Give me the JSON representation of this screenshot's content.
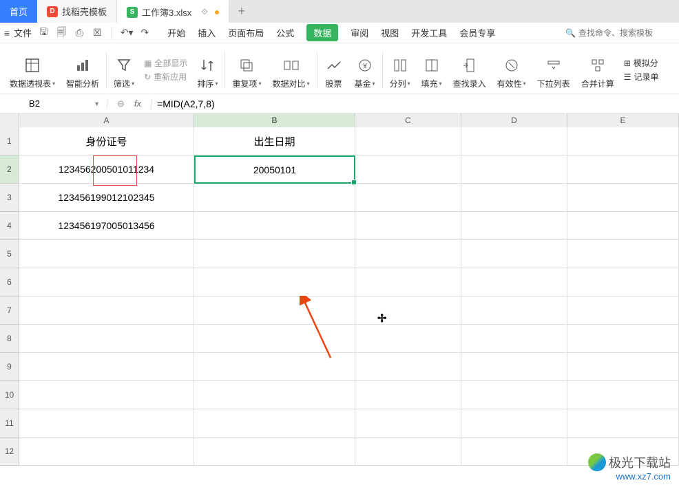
{
  "tabs": {
    "home": "首页",
    "doc1": "找稻壳模板",
    "doc2": "工作簿3.xlsx"
  },
  "menu": {
    "file": "文件",
    "items": [
      "开始",
      "插入",
      "页面布局",
      "公式",
      "数据",
      "审阅",
      "视图",
      "开发工具",
      "会员专享"
    ],
    "search_placeholder": "查找命令、搜索模板"
  },
  "ribbon": {
    "pivot": "数据透视表",
    "smart": "智能分析",
    "filter": "筛选",
    "showall": "全部显示",
    "reapply": "重新应用",
    "sort": "排序",
    "dup": "重复项",
    "compare": "数据对比",
    "stock": "股票",
    "fund": "基金",
    "split": "分列",
    "fill": "填充",
    "lookup": "查找录入",
    "valid": "有效性",
    "dropdown": "下拉列表",
    "consol": "合并计算",
    "simulate": "模拟分",
    "record": "记录单"
  },
  "formula_bar": {
    "cell": "B2",
    "formula": "=MID(A2,7,8)"
  },
  "sheet": {
    "cols": [
      "A",
      "B",
      "C",
      "D",
      "E"
    ],
    "headers": {
      "A": "身份证号",
      "B": "出生日期"
    },
    "rows": [
      {
        "A": "123456200501011234",
        "B": "20050101"
      },
      {
        "A": "123456199012102345",
        "B": ""
      },
      {
        "A": "123456197005013456",
        "B": ""
      }
    ]
  },
  "watermark": {
    "name": "极光下载站",
    "url": "www.xz7.com"
  }
}
